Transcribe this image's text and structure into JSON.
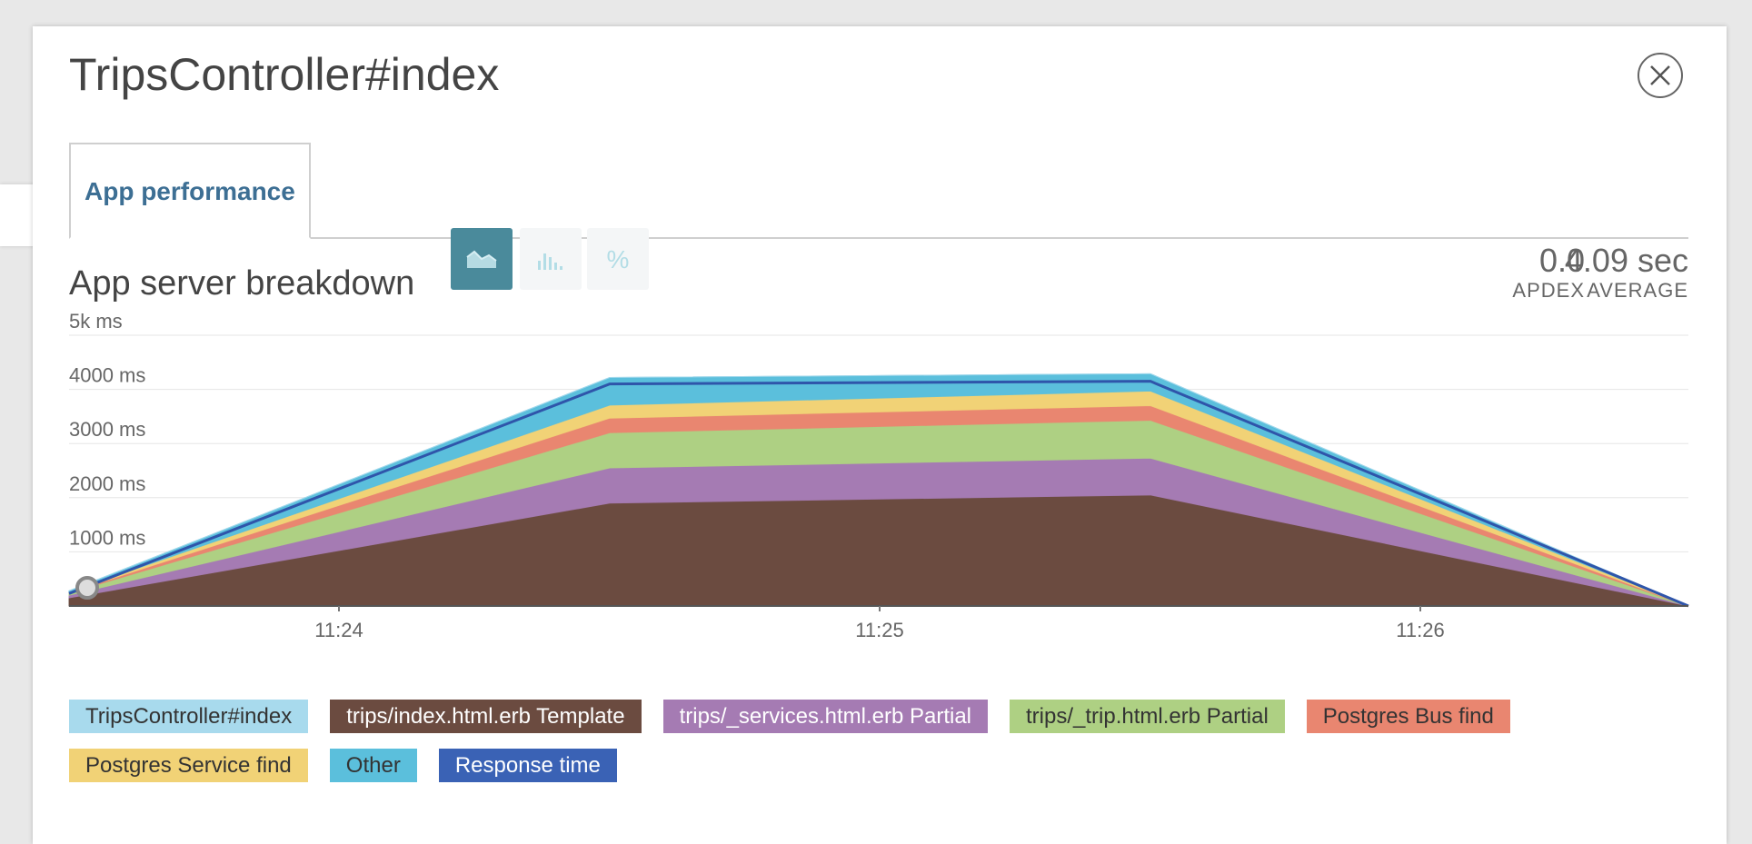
{
  "modal": {
    "title": "TripsController#index",
    "tabs": [
      {
        "label": "App performance"
      }
    ]
  },
  "section": {
    "title": "App server breakdown",
    "view_buttons": [
      {
        "icon": "area-chart-icon",
        "active": true
      },
      {
        "icon": "bar-chart-icon",
        "active": false
      },
      {
        "icon": "percent-icon",
        "active": false
      }
    ],
    "percent_symbol": "%"
  },
  "stats": {
    "apdex": {
      "value": "0.0",
      "label": "APDEX"
    },
    "average": {
      "value": "4.09 sec",
      "label": "AVERAGE"
    }
  },
  "colors": {
    "accent": "#3d6f94",
    "active_button": "#4a8a9b"
  },
  "chart_data": {
    "type": "area",
    "stacked": true,
    "x": [
      "11:23:30",
      "11:24:30",
      "11:25:30",
      "11:26:30"
    ],
    "xticks": [
      "11:24",
      "11:25",
      "11:26"
    ],
    "yticks": [
      "1000 ms",
      "2000 ms",
      "3000 ms",
      "4000 ms",
      "5k ms"
    ],
    "ylim": [
      0,
      5000
    ],
    "grid": true,
    "legend_position": "bottom",
    "series": [
      {
        "name": "trips/index.html.erb Template",
        "color": "#6b4b40",
        "values": [
          150,
          1900,
          2050,
          0
        ]
      },
      {
        "name": "trips/_services.html.erb Partial",
        "color": "#a57bb3",
        "values": [
          50,
          650,
          680,
          0
        ]
      },
      {
        "name": "trips/_trip.html.erb Partial",
        "color": "#aed083",
        "values": [
          40,
          650,
          700,
          0
        ]
      },
      {
        "name": "Postgres Bus find",
        "color": "#e98670",
        "values": [
          10,
          270,
          270,
          0
        ]
      },
      {
        "name": "Postgres Service find",
        "color": "#f1d276",
        "values": [
          10,
          240,
          270,
          0
        ]
      },
      {
        "name": "Other",
        "color": "#5bbfdc",
        "values": [
          20,
          510,
          320,
          0
        ]
      },
      {
        "name": "TripsController#index",
        "color": "#a8daed",
        "values": [
          0,
          0,
          0,
          0
        ]
      }
    ],
    "lines": [
      {
        "name": "Response time",
        "color": "#2f55aa",
        "values": [
          230,
          4100,
          4150,
          0
        ]
      }
    ],
    "legend_order": [
      {
        "name": "TripsController#index",
        "color": "#a8daed",
        "text": "dark"
      },
      {
        "name": "trips/index.html.erb Template",
        "color": "#6b4b40",
        "text": "light"
      },
      {
        "name": "trips/_services.html.erb Partial",
        "color": "#a57bb3",
        "text": "light"
      },
      {
        "name": "trips/_trip.html.erb Partial",
        "color": "#aed083",
        "text": "dark"
      },
      {
        "name": "Postgres Bus find",
        "color": "#e98670",
        "text": "dark"
      },
      {
        "name": "Postgres Service find",
        "color": "#f1d276",
        "text": "dark"
      },
      {
        "name": "Other",
        "color": "#5bbfdc",
        "text": "dark"
      },
      {
        "name": "Response time",
        "color": "#3a62b5",
        "text": "light"
      }
    ]
  }
}
